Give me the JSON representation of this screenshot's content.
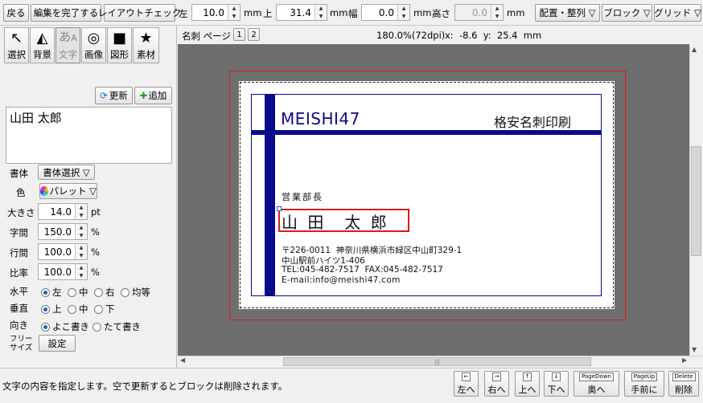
{
  "toolbar": {
    "back": "戻る",
    "finish": "編集を完了する",
    "layout_check": "レイアウトチェック",
    "left_label": "左",
    "left_value": "10.0",
    "mm1": "mm",
    "top_label": "上",
    "top_value": "31.4",
    "mm2": "mm",
    "width_label": "幅",
    "width_value": "0.0",
    "mm3": "mm",
    "height_label": "高さ",
    "height_value": "0.0",
    "mm4": "mm",
    "arrange": "配置・整列 ▽",
    "block": "ブロック ▽",
    "grid": "グリッド ▽"
  },
  "tools": [
    {
      "label": "選択",
      "icon": "pointer-icon"
    },
    {
      "label": "背景",
      "icon": "mountain-icon"
    },
    {
      "label": "文字",
      "icon": "text-icon"
    },
    {
      "label": "画像",
      "icon": "image-icon"
    },
    {
      "label": "図形",
      "icon": "shape-icon"
    },
    {
      "label": "素材",
      "icon": "star-icon"
    }
  ],
  "text_panel": {
    "update": "更新",
    "add": "追加",
    "content": "山田 太郎"
  },
  "props": {
    "font_label": "書体",
    "font_select": "書体選択 ▽",
    "color_label": "色",
    "palette": "パレット ▽",
    "size_label": "大きさ",
    "size_value": "14.0",
    "size_unit": "pt",
    "charsp_label": "字間",
    "charsp_value": "150.0",
    "charsp_unit": "%",
    "linesp_label": "行間",
    "linesp_value": "100.0",
    "linesp_unit": "%",
    "ratio_label": "比率",
    "ratio_value": "100.0",
    "ratio_unit": "%",
    "halign_label": "水平",
    "halign_options": [
      "左",
      "中",
      "右",
      "均等"
    ],
    "valign_label": "垂直",
    "valign_options": [
      "上",
      "中",
      "下"
    ],
    "dir_label": "向き",
    "dir_options": [
      "よこ書き",
      "たて書き"
    ],
    "free_label_1": "フリー",
    "free_label_2": "サイズ",
    "setting": "設定"
  },
  "canvas_header": {
    "page_label": "名刺 ページ",
    "pages": [
      "1",
      "2"
    ],
    "zoom": "180.0%(72dpi)",
    "coord": "x:  -8.6  y:  25.4  mm"
  },
  "card": {
    "brand": "MEISHI47",
    "tagline": "格安名刺印刷",
    "department": "営業部長",
    "name": "山 田　太 郎",
    "address_lines": [
      "〒226-0011  神奈川県横浜市緑区中山町329-1",
      "中山駅前ハイツ1-406",
      "TEL:045-482-7517  FAX:045-482-7517",
      "E-mail:info@meishi47.com"
    ],
    "accent_color": "#0a0a8c"
  },
  "status": {
    "message": "文字の内容を指定します。空で更新するとブロックは削除されます。"
  },
  "nav_buttons": [
    {
      "key": "←",
      "label": "左へ"
    },
    {
      "key": "→",
      "label": "右へ"
    },
    {
      "key": "↑",
      "label": "上へ"
    },
    {
      "key": "↓",
      "label": "下へ"
    },
    {
      "key": "PageDown",
      "label": "奥へ"
    },
    {
      "key": "PageUp",
      "label": "手前に"
    },
    {
      "key": "Delete",
      "label": "削除"
    }
  ]
}
